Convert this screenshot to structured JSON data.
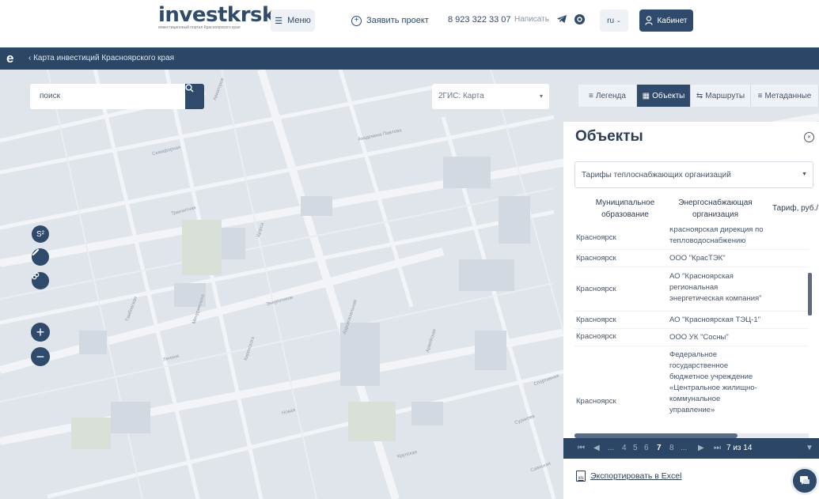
{
  "header": {
    "logo": "investkrsk",
    "logo_subtitle": "инвестиционный портал Красноярского края",
    "menu_label": "Меню",
    "propose_label": "Заявить проект",
    "phone": "8 923 322 33 07",
    "write_label": "Написать",
    "lang_label": "ru",
    "cabinet_label": "Кабинет"
  },
  "mapbar": {
    "logo_letter": "e",
    "breadcrumb": "Карта инвестиций Красноярского края"
  },
  "map": {
    "search_placeholder": "поиск",
    "basemap_value": "2ГИС: Карта",
    "zoom_in": "+",
    "zoom_out": "−",
    "labels": [
      "Авиаторов",
      "Академика Павлова",
      "Семафорная",
      "Транзитная",
      "Тамбовская",
      "Щорса",
      "Энергетиков",
      "Аэровокзальная",
      "Мичуринского",
      "Киренского",
      "Новая",
      "Крупская",
      "Спортивная",
      "Сурикова",
      "Саянская",
      "Армейская",
      "Ленина"
    ]
  },
  "tabs": [
    {
      "label": "Легенда",
      "icon": "list-icon",
      "active": false
    },
    {
      "label": "Объекты",
      "icon": "table-icon",
      "active": true
    },
    {
      "label": "Маршруты",
      "icon": "route-icon",
      "active": false
    },
    {
      "label": "Метаданные",
      "icon": "list-icon",
      "active": false
    }
  ],
  "panel": {
    "title": "Объекты",
    "layer_select": "Тарифы теплоснабжающих организаций",
    "columns": [
      "Муниципальное образование",
      "Энергоснабжающая организация",
      "Тариф, руб./"
    ],
    "rows": [
      {
        "municipality": "Красноярск",
        "org": "Красноярская дирекция по тепловодоснабжению"
      },
      {
        "municipality": "Красноярск",
        "org": "ООО \"КрасТЭК\""
      },
      {
        "municipality": "Красноярск",
        "org": "АО \"Красноярская региональная энергетическая компания\""
      },
      {
        "municipality": "Красноярск",
        "org": "АО \"Красноярская ТЭЦ-1\""
      },
      {
        "municipality": "Красноярск",
        "org": "ООО УК \"Сосны\""
      },
      {
        "municipality": "Красноярск",
        "org": "Федеральное государственное бюджетное учреждение «Центральное жилищно-коммунальное управление»"
      }
    ]
  },
  "pager": {
    "first": "⏮",
    "prev": "◀",
    "pages": [
      "...",
      "4",
      "5",
      "6",
      "7",
      "8",
      "..."
    ],
    "current": "7",
    "next": "▶",
    "last": "⏭",
    "summary": "7 из 14",
    "filter_icon": "filter-icon"
  },
  "export_label": "Экспортировать в Excel",
  "colors": {
    "primary": "#2f4a6b",
    "map_bg": "#e0e5ec",
    "bar": "#2c4666"
  }
}
